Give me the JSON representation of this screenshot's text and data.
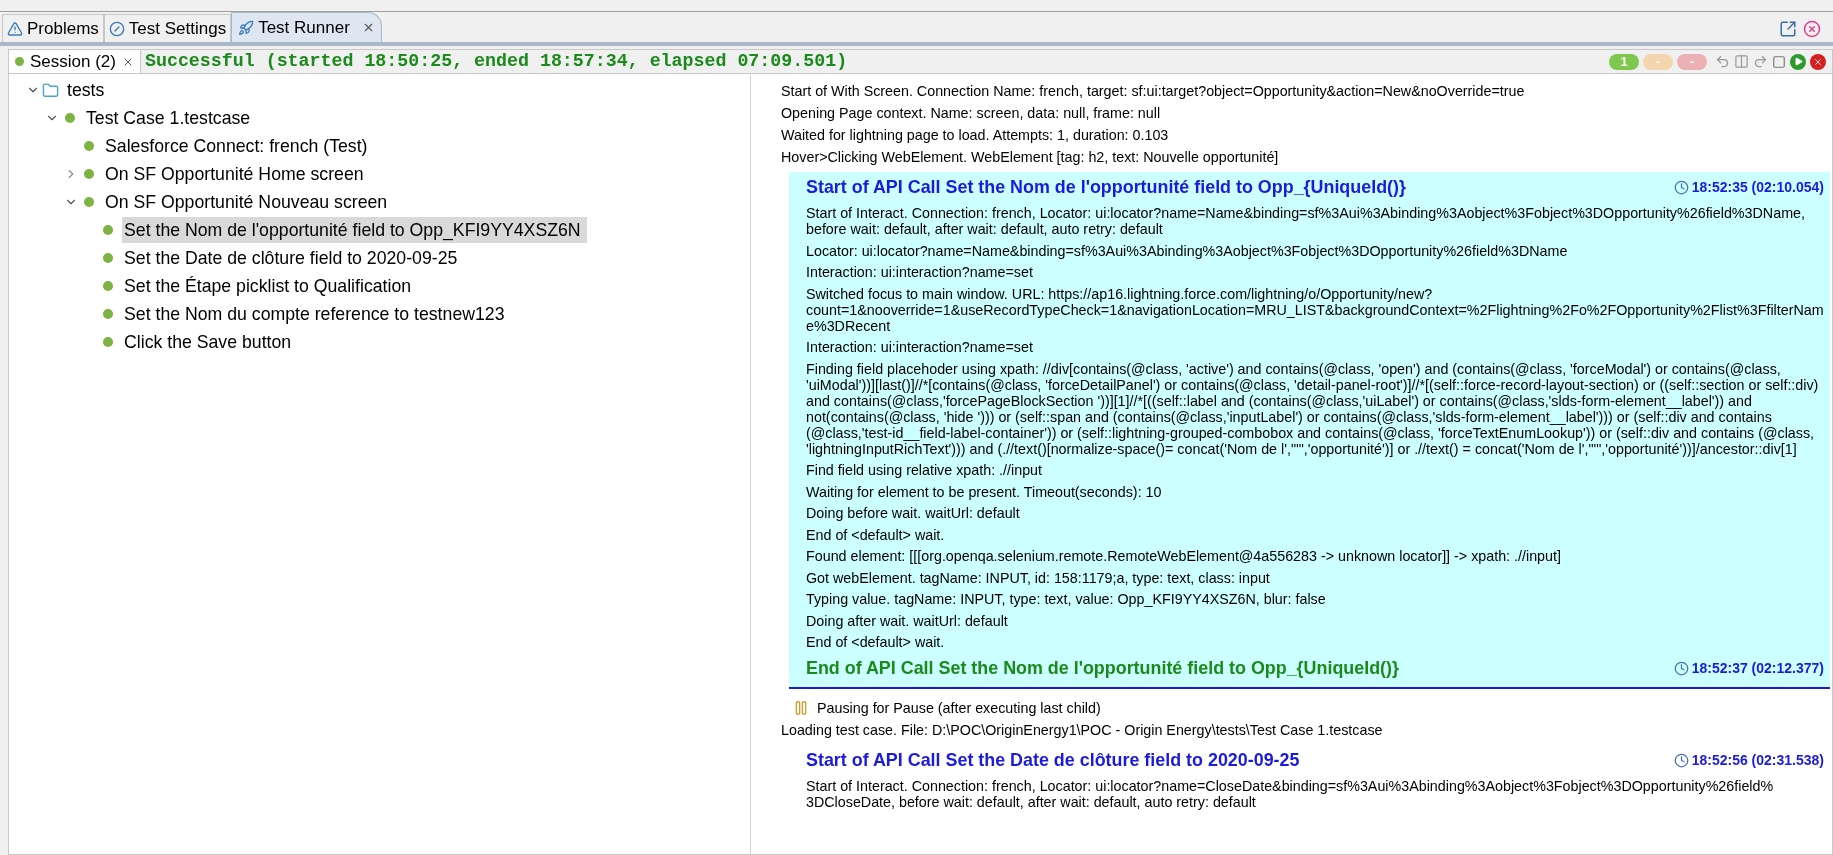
{
  "tabs": [
    {
      "label": "Problems",
      "selected": false,
      "closable": false
    },
    {
      "label": "Test Settings",
      "selected": false,
      "closable": false
    },
    {
      "label": "Test Runner",
      "selected": true,
      "closable": true
    }
  ],
  "session": {
    "label": "Session (2)",
    "status": "Successful (started 18:50:25, ended 18:57:34, elapsed 07:09.501)"
  },
  "counters": [
    {
      "text": "1",
      "color": "#7ec850"
    },
    {
      "text": "-",
      "color": "#f5d5b0"
    },
    {
      "text": "-",
      "color": "#ecb0b5"
    }
  ],
  "tree": [
    {
      "label": "tests",
      "kind": "folder",
      "expanded": true,
      "selected": false,
      "children": [
        {
          "label": "Test Case 1.testcase",
          "kind": "step",
          "expanded": true,
          "selected": false,
          "children": [
            {
              "label": "Salesforce Connect: french (Test)",
              "kind": "step",
              "selected": false
            },
            {
              "label": "On SF Opportunité Home screen",
              "kind": "step",
              "expanded": false,
              "selected": false
            },
            {
              "label": "On SF Opportunité Nouveau screen",
              "kind": "step",
              "expanded": true,
              "selected": false,
              "children": [
                {
                  "label": "Set the Nom de l'opportunité field to Opp_KFI9YY4XSZ6N",
                  "kind": "step",
                  "selected": true
                },
                {
                  "label": "Set the Date de clôture field to 2020-09-25",
                  "kind": "step",
                  "selected": false
                },
                {
                  "label": "Set the Étape picklist to Qualification",
                  "kind": "step",
                  "selected": false
                },
                {
                  "label": "Set the Nom du compte reference to testnew123",
                  "kind": "step",
                  "selected": false
                },
                {
                  "label": "Click the Save button",
                  "kind": "step",
                  "selected": false
                }
              ]
            }
          ]
        }
      ]
    }
  ],
  "log": [
    {
      "kind": "line",
      "text": "Start of With Screen. Connection Name: french, target: sf:ui:target?object=Opportunity&action=New&noOverride=true"
    },
    {
      "kind": "line",
      "text": "Opening Page context. Name: screen, data: null, frame: null"
    },
    {
      "kind": "line",
      "text": "Waited for lightning page to load. Attempts: 1, duration: 0.103"
    },
    {
      "kind": "line",
      "text": "Hover>Clicking WebElement. WebElement [tag: h2, text: Nouvelle opportunité]"
    },
    {
      "kind": "api_call",
      "selected": true,
      "title": "Start of API Call Set the Nom de l'opportunité field to Opp_{UniqueId()}",
      "time": "18:52:35 (02:10.054)",
      "lines": [
        "Start of Interact. Connection: french, Locator: ui:locator?name=Name&binding=sf%3Aui%3Abinding%3Aobject%3Fobject%3DOpportunity%26field%3DName, before wait: default, after wait: default, auto retry: default",
        "Locator: ui:locator?name=Name&binding=sf%3Aui%3Abinding%3Aobject%3Fobject%3DOpportunity%26field%3DName",
        "Interaction: ui:interaction?name=set",
        "Switched focus to main window. URL: https://ap16.lightning.force.com/lightning/o/Opportunity/new? count=1&nooverride=1&useRecordTypeCheck=1&navigationLocation=MRU_LIST&backgroundContext=%2Flightning%2Fo%2FOpportunity%2Flist%3FfilterName%3DRecent",
        "Interaction: ui:interaction?name=set",
        "Finding field placehoder using xpath: //div[contains(@class, 'active') and contains(@class, 'open') and (contains(@class, 'forceModal') or contains(@class, 'uiModal'))][last()]//*[contains(@class, 'forceDetailPanel') or contains(@class, 'detail-panel-root')]//*[(self::force-record-layout-section) or ((self::section or self::div) and contains(@class,'forcePageBlockSection '))][1]//*[((self::label and (contains(@class,'uiLabel') or contains(@class,'slds-form-element__label')) and not(contains(@class, 'hide '))) or (self::span and (contains(@class,'inputLabel') or contains(@class,'slds-form-element__label'))) or (self::div and contains (@class,'test-id__field-label-container')) or (self::lightning-grouped-combobox and contains(@class, 'forceTextEnumLookup')) or (self::div and contains (@class, 'lightningInputRichText'))) and (.//text()[normalize-space()= concat('Nom de l',\"'\",'opportunité')] or .//text() = concat('Nom de l',\"'\",'opportunité'))]/ancestor::div[1]",
        "Find field using relative xpath: .//input",
        "Waiting for element to be present. Timeout(seconds): 10",
        "Doing before wait. waitUrl: default",
        "End of <default> wait.",
        "Found element: [[[org.openqa.selenium.remote.RemoteWebElement@4a556283 -> unknown locator]] -> xpath: .//input]",
        "Got webElement. tagName: INPUT, id: 158:1179;a, type: text, class: input",
        "Typing value. tagName: INPUT, type: text, value: Opp_KFI9YY4XSZ6N, blur: false",
        "Doing after wait. waitUrl: default",
        "End of <default> wait."
      ],
      "end_title": "End of API Call Set the Nom de l'opportunité field to Opp_{UniqueId()}",
      "end_time": "18:52:37 (02:12.377)"
    },
    {
      "kind": "pause",
      "text": "Pausing for Pause (after executing last child)"
    },
    {
      "kind": "line",
      "text": "Loading test case. File: D:\\POC\\OriginEnergy1\\POC - Origin Energy\\tests\\Test Case 1.testcase"
    },
    {
      "kind": "api_call",
      "selected": false,
      "title": "Start of API Call Set the Date de clôture field to 2020-09-25",
      "time": "18:52:56 (02:31.538)",
      "lines": [
        "Start of Interact. Connection: french, Locator: ui:locator?name=CloseDate&binding=sf%3Aui%3Abinding%3Aobject%3Fobject%3DOpportunity%26field% 3DCloseDate, before wait: default, after wait: default, auto retry: default"
      ]
    }
  ]
}
